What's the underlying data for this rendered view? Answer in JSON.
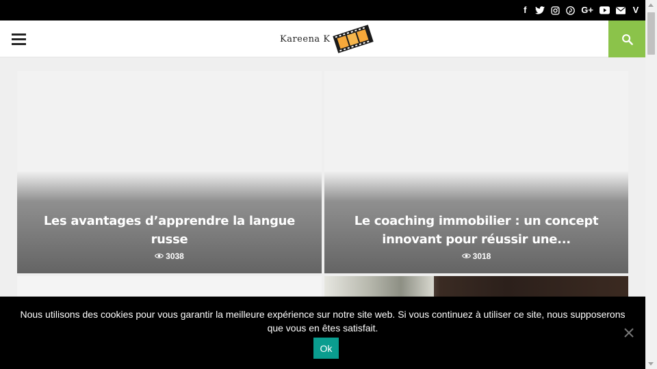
{
  "topbar": {
    "social": [
      {
        "icon": "facebook-icon",
        "glyph": "f"
      },
      {
        "icon": "twitter-icon",
        "glyph": ""
      },
      {
        "icon": "instagram-icon",
        "glyph": ""
      },
      {
        "icon": "pinterest-icon",
        "glyph": ""
      },
      {
        "icon": "google-plus-icon",
        "glyph": "G+"
      },
      {
        "icon": "youtube-icon",
        "glyph": ""
      },
      {
        "icon": "email-icon",
        "glyph": ""
      },
      {
        "icon": "vimeo-icon",
        "glyph": "V"
      }
    ]
  },
  "header": {
    "logo_text": "Kareena K",
    "accent_color": "#8bc34a"
  },
  "cards": [
    {
      "title": "Les avantages d’apprendre la langue russe",
      "views": "3038"
    },
    {
      "title": "Le coaching immobilier : un concept innovant pour réussir une...",
      "views": "3018"
    }
  ],
  "cookie": {
    "text": "Nous utilisons des cookies pour vous garantir la meilleure expérience sur notre site web. Si vous continuez à utiliser ce site, nous supposerons que vous en êtes satisfait.",
    "ok_label": "Ok",
    "button_color": "#0a9d8f"
  }
}
